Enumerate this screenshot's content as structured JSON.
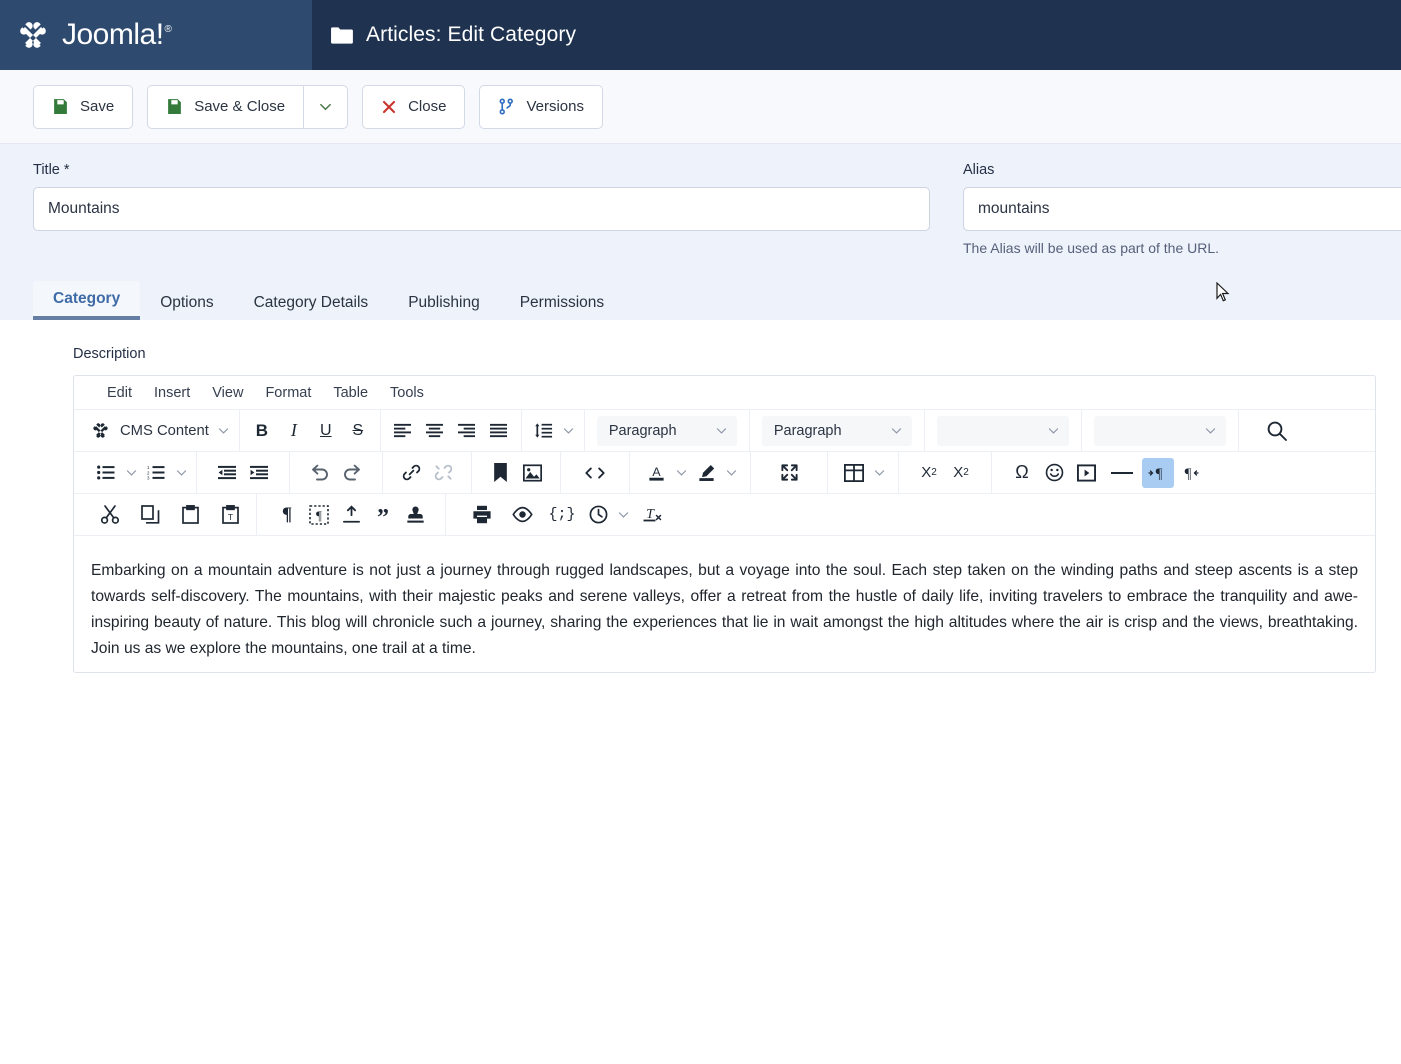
{
  "header": {
    "brand_name": "Joomla!",
    "brand_reg": "®",
    "page_icon": "folder-icon",
    "title": "Articles: Edit Category",
    "brand_bg": "#2e4a6e",
    "title_bg": "#1f3350"
  },
  "toolbar": {
    "save_label": "Save",
    "save_close_label": "Save & Close",
    "close_label": "Close",
    "versions_label": "Versions",
    "save_icon_color": "#337a3b",
    "close_icon_color": "#c9342c",
    "versions_icon_color": "#2d6cc0"
  },
  "fields": {
    "title_label": "Title *",
    "title_value": "Mountains",
    "title_placeholder": "",
    "alias_label": "Alias",
    "alias_value": "mountains",
    "alias_placeholder": "",
    "alias_help": "The Alias will be used as part of the URL."
  },
  "tabs": [
    {
      "label": "Category",
      "active": true
    },
    {
      "label": "Options",
      "active": false
    },
    {
      "label": "Category Details",
      "active": false
    },
    {
      "label": "Publishing",
      "active": false
    },
    {
      "label": "Permissions",
      "active": false
    }
  ],
  "editor": {
    "description_label": "Description",
    "menus": [
      "Edit",
      "Insert",
      "View",
      "Format",
      "Table",
      "Tools"
    ],
    "cms_content_label": "CMS Content",
    "paragraph_style": "Paragraph",
    "paragraph_block": "Paragraph",
    "font_family": "",
    "font_size": "",
    "ltr_active": true,
    "body_text": "Embarking on a mountain adventure is not just a journey through rugged landscapes, but a voyage into the soul. Each step taken on the winding paths and steep ascents is a step towards self-discovery. The mountains, with their majestic peaks and serene valleys, offer a retreat from the hustle of daily life, inviting travelers to embrace the tranquility and awe-inspiring beauty of nature. This blog will chronicle such a journey, sharing the experiences that lie in wait amongst the high altitudes where the air is crisp and the views, breathtaking. Join us as we explore the mountains, one trail at a time."
  }
}
